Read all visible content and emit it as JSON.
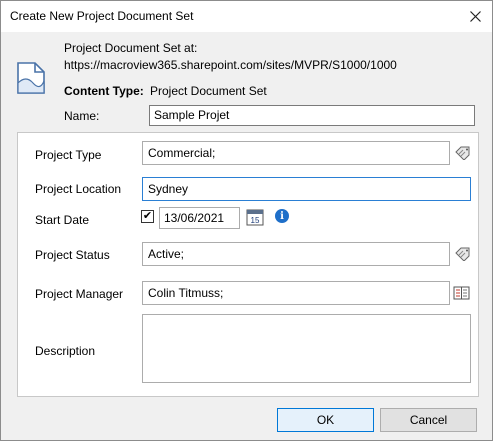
{
  "window": {
    "title": "Create New Project Document Set"
  },
  "header": {
    "location_label": "Project Document Set at:",
    "location_url": "https://macroview365.sharepoint.com/sites/MVPR/S1000/1000",
    "content_type_label": "Content Type:",
    "content_type_value": "Project Document Set",
    "name_label": "Name:",
    "name_value": "Sample Projet"
  },
  "fields": {
    "project_type": {
      "label": "Project Type",
      "value": "Commercial;"
    },
    "project_location": {
      "label": "Project Location",
      "value": "Sydney"
    },
    "start_date": {
      "label": "Start Date",
      "checked": true,
      "value": "13/06/2021",
      "calendar_day": "15"
    },
    "project_status": {
      "label": "Project Status",
      "value": "Active;"
    },
    "project_manager": {
      "label": "Project Manager",
      "value": "Colin Titmuss;"
    },
    "description": {
      "label": "Description",
      "value": ""
    }
  },
  "buttons": {
    "ok": "OK",
    "cancel": "Cancel"
  },
  "icons": {
    "close": "close-icon",
    "document": "document-icon",
    "tags": "tags-icon",
    "calendar": "calendar-icon",
    "info": "info-icon",
    "address_book": "address-book-icon"
  },
  "colors": {
    "accent": "#0078d7",
    "info": "#1e6fc9",
    "focus_border": "#2a7fd4"
  }
}
